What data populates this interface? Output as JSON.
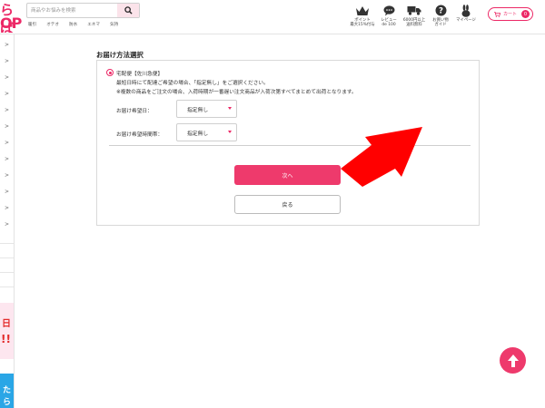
{
  "header": {
    "logo_top": "らば",
    "logo_bottom": "OP",
    "search_placeholder": "商品やお悩みを検索",
    "quicklinks": [
      "暖引",
      "オテオ",
      "防水",
      "エネマ",
      "気持"
    ],
    "nav": [
      {
        "icon": "crown-icon",
        "line1": "ポイント",
        "line2": "最大15%付与"
      },
      {
        "icon": "chat-bubble-icon",
        "line1": "レビュー",
        "line2": "de 100"
      },
      {
        "icon": "truck-icon",
        "line1": "6000円以上",
        "line2": "送料無料"
      },
      {
        "icon": "help-icon",
        "line1": "お買い物",
        "line2": "ガイド"
      },
      {
        "icon": "user-rabbit-icon",
        "line1": "マイページ",
        "line2": ""
      }
    ],
    "cart_label": "カート",
    "cart_count": "0"
  },
  "sidebar": {
    "chevron": ">",
    "banner1_text": "日",
    "banner1_text2": "!!",
    "banner2_text": "たら"
  },
  "main": {
    "section_title": "お届け方法選択",
    "shipping_option_label": "宅配便【佐川急便】",
    "note1": "最短日時にて配達ご希望の場合、「指定無し」をご選択ください。",
    "note2": "※複数の商品をご注文の場合、入荷時期が一番遅い注文商品が入荷次第すべてまとめて出荷となります。",
    "delivery_date_label": "お届け希望日：",
    "delivery_date_value": "指定無し",
    "delivery_time_label": "お届け希望時間帯：",
    "delivery_time_value": "指定無し",
    "next_label": "次へ",
    "back_label": "戻る"
  },
  "colors": {
    "brand_pink": "#ee3a6c",
    "annotation_red": "#ff0000"
  }
}
